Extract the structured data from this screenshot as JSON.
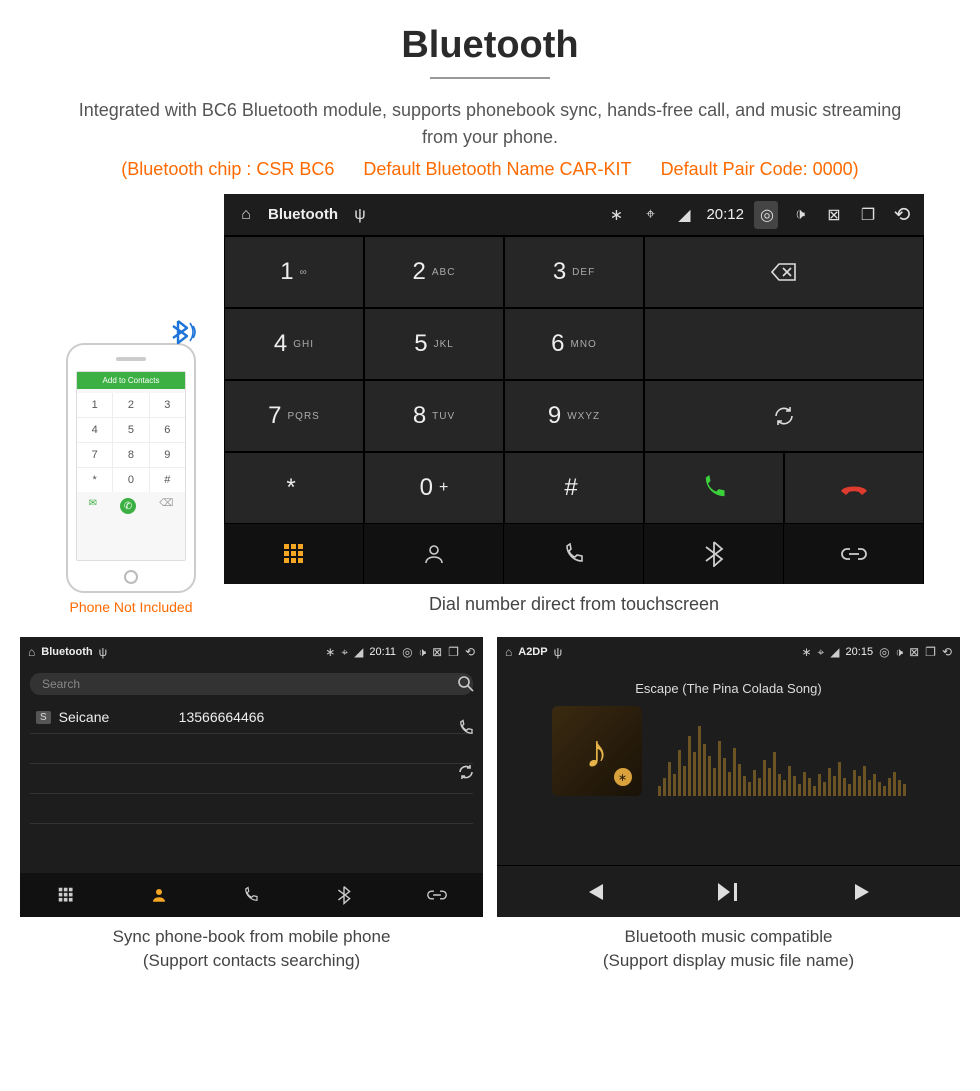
{
  "title": "Bluetooth",
  "intro": "Integrated with BC6 Bluetooth module, supports phonebook sync, hands-free call, and music streaming from your phone.",
  "specs": {
    "chip": "(Bluetooth chip : CSR BC6",
    "name": "Default Bluetooth Name CAR-KIT",
    "pair": "Default Pair Code: 0000)"
  },
  "phone_mock": {
    "header": "Add to Contacts",
    "keys": [
      "1",
      "2",
      "3",
      "4",
      "5",
      "6",
      "7",
      "8",
      "9",
      "*",
      "0",
      "#"
    ],
    "note": "Phone Not Included"
  },
  "dialer": {
    "status": {
      "title": "Bluetooth",
      "time": "20:12"
    },
    "keys": [
      {
        "num": "1",
        "lbl": "∞"
      },
      {
        "num": "2",
        "lbl": "ABC"
      },
      {
        "num": "3",
        "lbl": "DEF"
      },
      {
        "num": "4",
        "lbl": "GHI"
      },
      {
        "num": "5",
        "lbl": "JKL"
      },
      {
        "num": "6",
        "lbl": "MNO"
      },
      {
        "num": "7",
        "lbl": "PQRS"
      },
      {
        "num": "8",
        "lbl": "TUV"
      },
      {
        "num": "9",
        "lbl": "WXYZ"
      },
      {
        "num": "*",
        "lbl": ""
      },
      {
        "num": "0",
        "lbl": "+"
      },
      {
        "num": "#",
        "lbl": ""
      }
    ],
    "caption": "Dial number direct from touchscreen"
  },
  "phonebook": {
    "status": {
      "title": "Bluetooth",
      "time": "20:11"
    },
    "search_placeholder": "Search",
    "contact": {
      "badge": "S",
      "name": "Seicane",
      "number": "13566664466"
    },
    "caption_l1": "Sync phone-book from mobile phone",
    "caption_l2": "(Support contacts searching)"
  },
  "music": {
    "status": {
      "title": "A2DP",
      "time": "20:15"
    },
    "song": "Escape (The Pina Colada Song)",
    "caption_l1": "Bluetooth music compatible",
    "caption_l2": "(Support display music file name)"
  }
}
